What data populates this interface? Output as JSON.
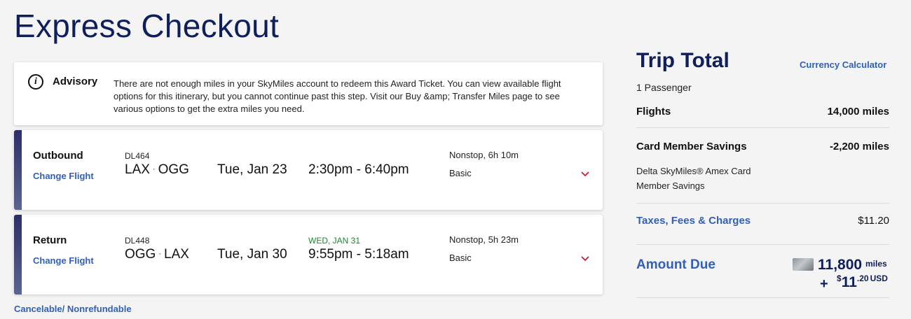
{
  "page": {
    "title": "Express Checkout",
    "top_mark": "’"
  },
  "advisory": {
    "title": "Advisory",
    "message": "There are not enough miles in your SkyMiles account to redeem this Award Ticket. You can view available flight options for this itinerary, but you cannot continue past this step. Visit our Buy &amp; Transfer Miles page to see various options to get the extra miles you need.",
    "icon": "info-icon"
  },
  "flights": [
    {
      "label": "Outbound",
      "change_link": "Change Flight",
      "flight_number": "DL464",
      "origin": "LAX",
      "destination": "OGG",
      "route_separator": "·",
      "date": "Tue, Jan 23",
      "next_day_note": "",
      "time": "2:30pm - 6:40pm",
      "stops_duration": "Nonstop, 6h 10m",
      "cabin": "Basic"
    },
    {
      "label": "Return",
      "change_link": "Change Flight",
      "flight_number": "DL448",
      "origin": "OGG",
      "destination": "LAX",
      "route_separator": "·",
      "date": "Tue, Jan 30",
      "next_day_note": "WED, JAN 31",
      "time": "9:55pm - 5:18am",
      "stops_duration": "Nonstop, 5h 23m",
      "cabin": "Basic"
    }
  ],
  "fare_note": "Cancelable/ Nonrefundable",
  "trip_total": {
    "title": "Trip Total",
    "currency_link": "Currency Calculator",
    "passengers": "1 Passenger",
    "flights_label": "Flights",
    "flights_value": "14,000 miles",
    "savings_label": "Card Member Savings",
    "savings_value": "-2,200 miles",
    "savings_desc_line1": "Delta SkyMiles® Amex Card",
    "savings_desc_line2": "Member Savings",
    "taxes_label": "Taxes, Fees & Charges",
    "taxes_value": "$11.20",
    "amount_due_label": "Amount Due",
    "amount_miles": "11,800",
    "amount_miles_unit": "miles",
    "amount_plus": "+",
    "amount_currency_symbol": "$",
    "amount_cash_whole": "11",
    "amount_cash_cents": ".20",
    "amount_currency": "USD"
  },
  "colors": {
    "brand_navy": "#0f1f5c",
    "link_blue": "#3060b8",
    "chevron_red": "#d01c2a",
    "next_day_green": "#1a8a2a"
  }
}
